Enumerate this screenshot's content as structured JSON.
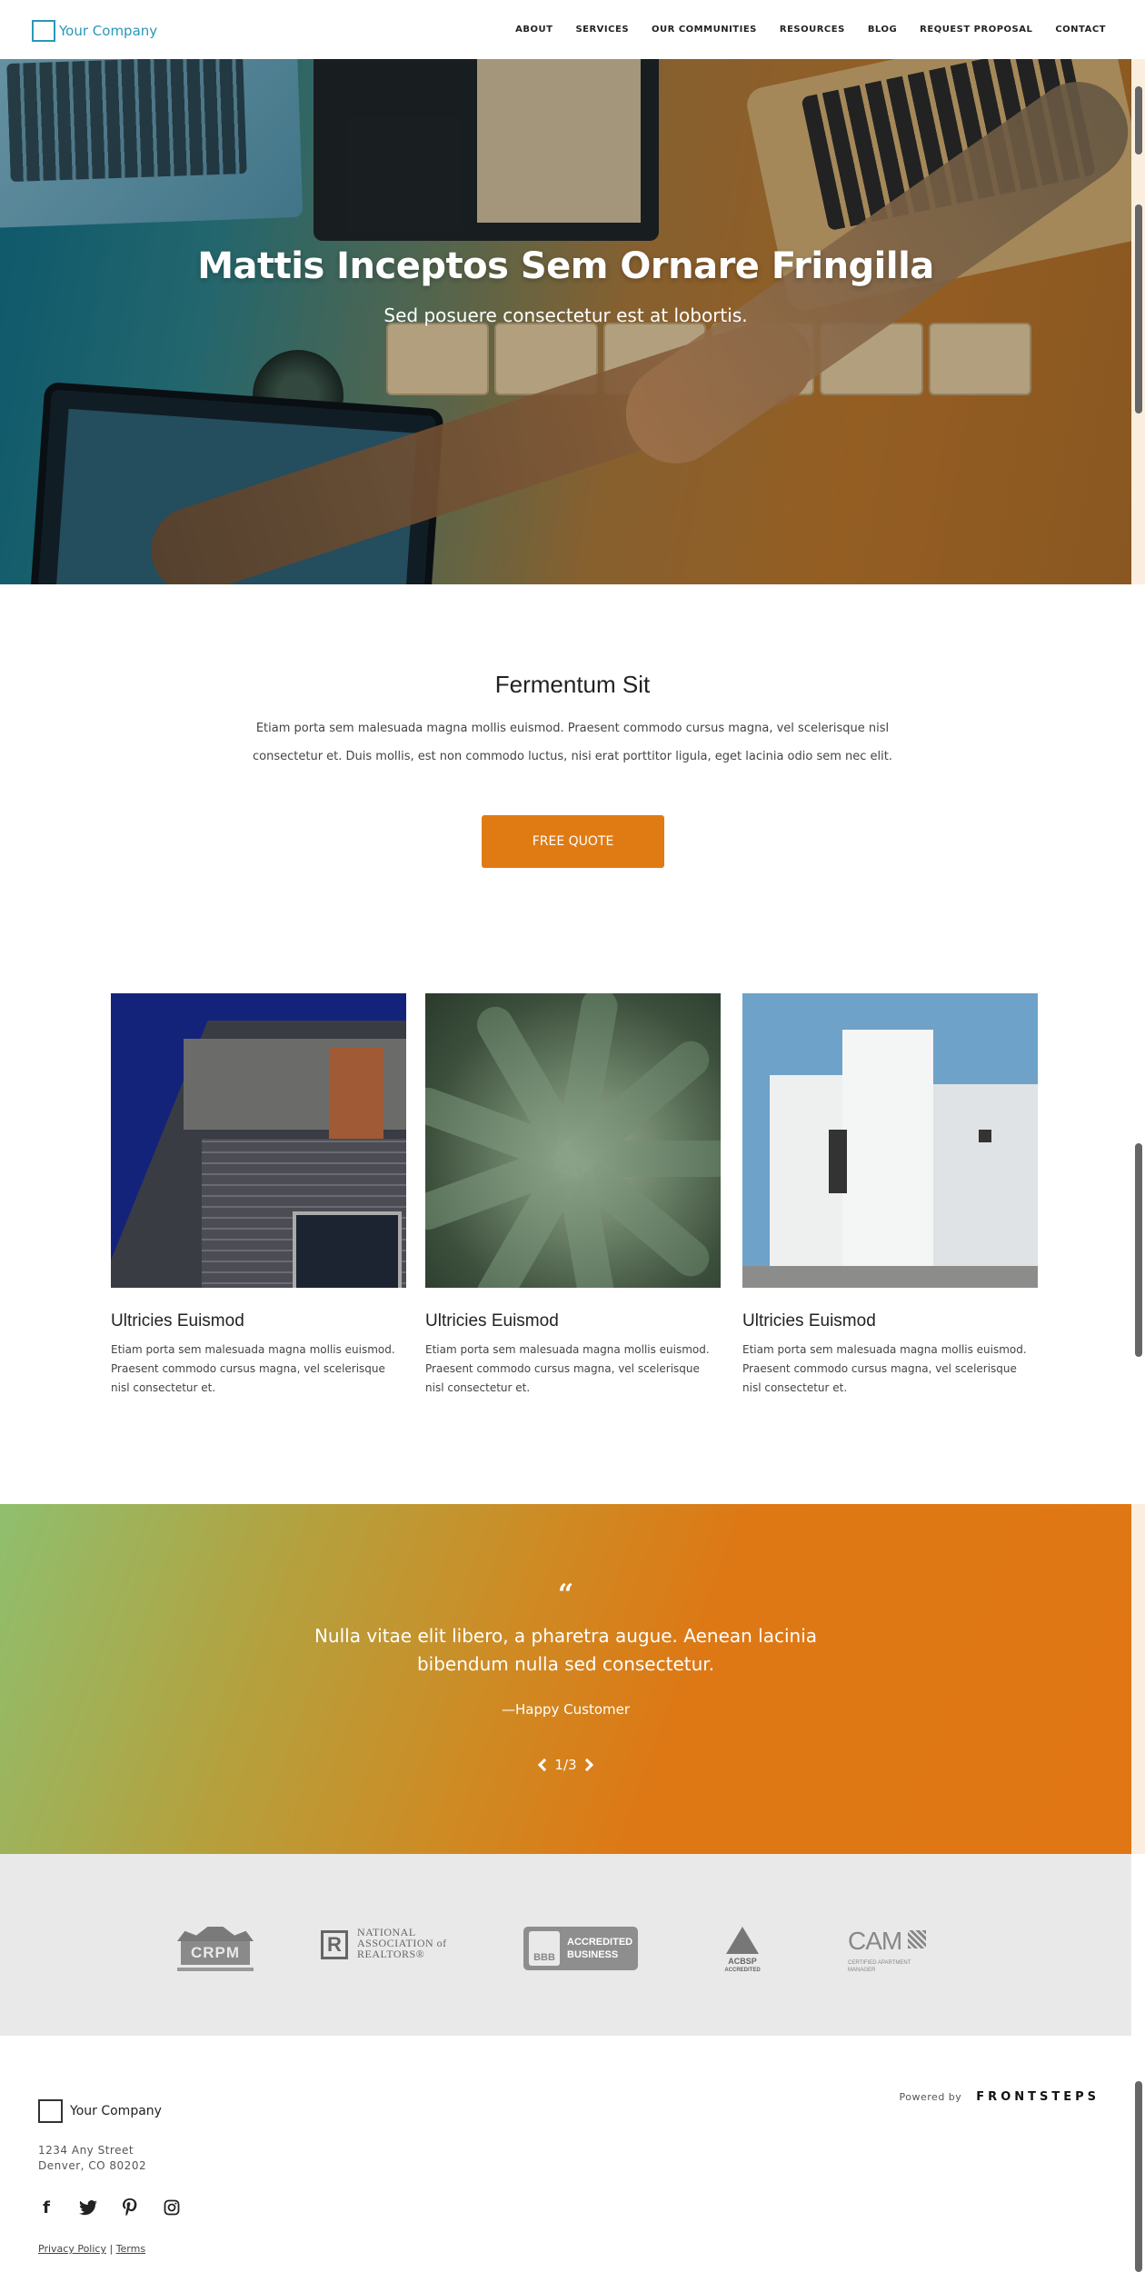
{
  "header": {
    "logo_text": "Your Company",
    "nav": [
      "ABOUT",
      "SERVICES",
      "OUR COMMUNITIES",
      "RESOURCES",
      "BLOG",
      "REQUEST PROPOSAL",
      "CONTACT"
    ]
  },
  "hero": {
    "title": "Mattis Inceptos Sem Ornare Fringilla",
    "subtitle": "Sed posuere consectetur est at lobortis."
  },
  "intro": {
    "title": "Fermentum Sit",
    "text": "Etiam porta sem malesuada magna mollis euismod. Praesent commodo cursus magna, vel scelerisque nisl consectetur et. Duis mollis, est non commodo luctus, nisi erat porttitor ligula, eget lacinia odio sem nec elit.",
    "button": "FREE QUOTE"
  },
  "cards": [
    {
      "title": "Ultricies Euismod",
      "text": "Etiam porta sem malesuada magna mollis euismod. Praesent commodo cursus magna, vel scelerisque nisl consectetur et."
    },
    {
      "title": "Ultricies Euismod",
      "text": "Etiam porta sem malesuada magna mollis euismod. Praesent commodo cursus magna, vel scelerisque nisl consectetur et."
    },
    {
      "title": "Ultricies Euismod",
      "text": "Etiam porta sem malesuada magna mollis euismod. Praesent commodo cursus magna, vel scelerisque nisl consectetur et."
    }
  ],
  "testimonial": {
    "mark": "“",
    "quote": "Nulla vitae elit libero, a pharetra augue. Aenean lacinia bibendum nulla sed consectetur.",
    "author": "—Happy Customer",
    "pager": "1/3"
  },
  "logos": {
    "crpm": "CRPM",
    "nar_line1": "NATIONAL",
    "nar_line2": "ASSOCIATION of",
    "nar_line3": "REALTORS®",
    "bbb_mark": "BBB",
    "bbb_line1": "ACCREDITED",
    "bbb_line2": "BUSINESS",
    "acbsp": "ACBSP",
    "acbsp_sub": "ACCREDITED",
    "cam": "CAM",
    "cam_sub1": "CERTIFIED APARTMENT",
    "cam_sub2": "MANAGER"
  },
  "footer": {
    "company": "Your Company",
    "address_line1": "1234 Any Street",
    "address_line2": "Denver, CO 80202",
    "social": [
      "facebook-icon",
      "twitter-icon",
      "pinterest-icon",
      "instagram-icon"
    ],
    "privacy": "Privacy Policy",
    "separator": "|",
    "terms": "Terms",
    "powered_label": "Powered by",
    "powered_brand": "FRONTSTEPS"
  },
  "colors": {
    "accent": "#e07b14",
    "brand": "#2a97b8",
    "logo_band": "#e9e9e9"
  }
}
